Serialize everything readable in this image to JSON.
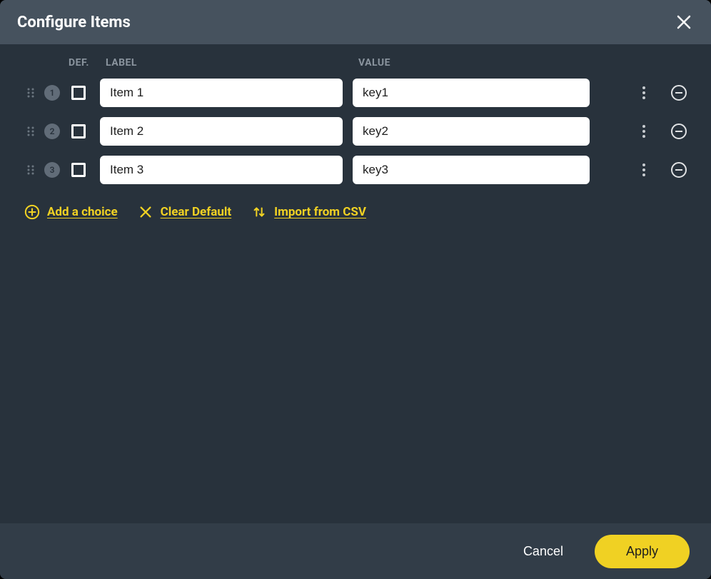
{
  "dialog": {
    "title": "Configure Items"
  },
  "headers": {
    "def": "DEF.",
    "label": "LABEL",
    "value": "VALUE"
  },
  "items": [
    {
      "index": "1",
      "label": "Item 1",
      "value": "key1"
    },
    {
      "index": "2",
      "label": "Item 2",
      "value": "key2"
    },
    {
      "index": "3",
      "label": "Item 3",
      "value": "key3"
    }
  ],
  "actions": {
    "add_choice": "Add a choice",
    "clear_default": "Clear Default",
    "import_csv": "Import from CSV"
  },
  "footer": {
    "cancel": "Cancel",
    "apply": "Apply"
  }
}
